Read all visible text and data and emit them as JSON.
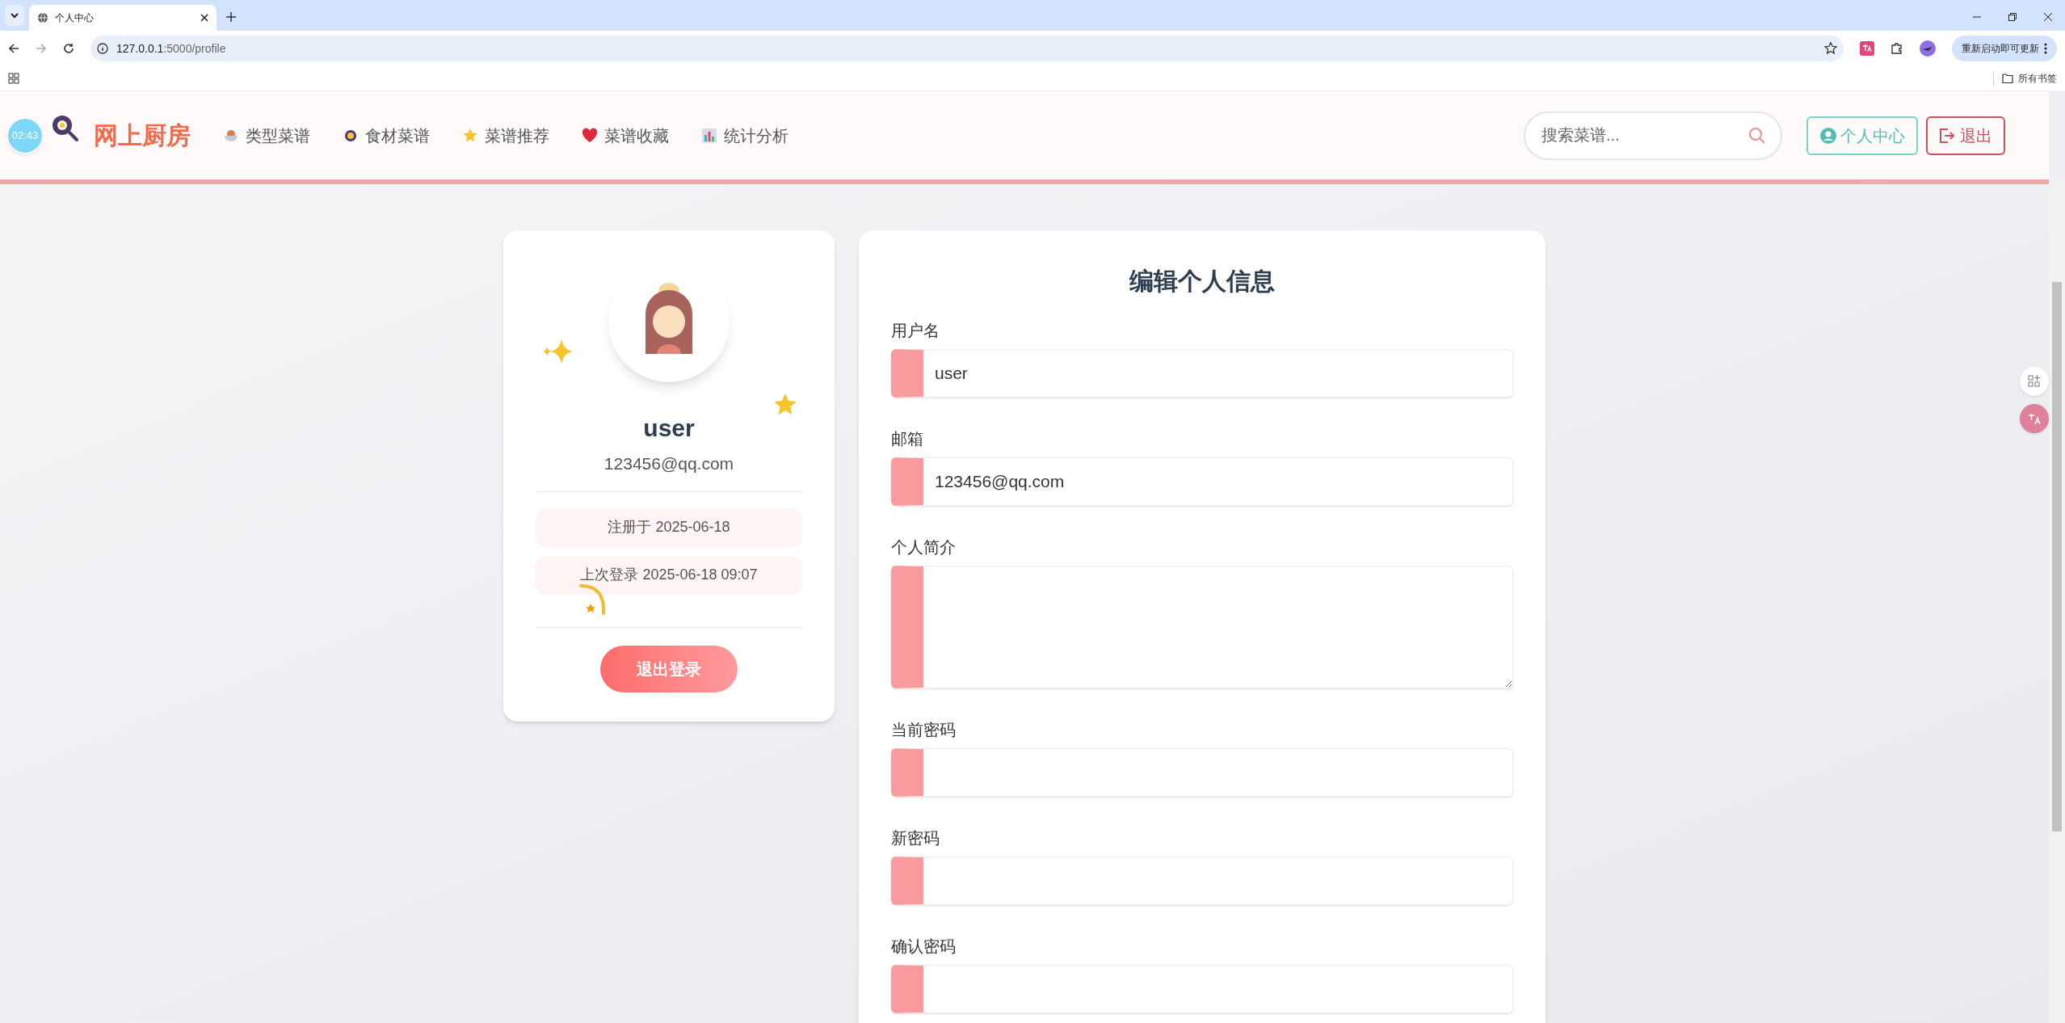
{
  "browser": {
    "tab_title": "个人中心",
    "url_host": "127.0.0.1",
    "url_path": ":5000/profile",
    "update_button": "重新启动即可更新",
    "bookmarks_folder": "所有书签"
  },
  "clock_badge": "02:43",
  "site": {
    "logo": "网上厨房",
    "nav": [
      {
        "label": "类型菜谱",
        "kind": "bowl"
      },
      {
        "label": "食材菜谱",
        "kind": "pan"
      },
      {
        "label": "菜谱推荐",
        "kind": "star"
      },
      {
        "label": "菜谱收藏",
        "kind": "heart"
      },
      {
        "label": "统计分析",
        "kind": "chart"
      }
    ],
    "search": {
      "placeholder": "搜索菜谱..."
    },
    "profile_button": "个人中心",
    "logout_button": "退出"
  },
  "profile": {
    "username": "user",
    "email": "123456@qq.com",
    "registered": "注册于 2025-06-18",
    "last_login": "上次登录 2025-06-18 09:07",
    "logout": "退出登录"
  },
  "form": {
    "title": "编辑个人信息",
    "fields": [
      {
        "label": "用户名",
        "value": "user",
        "kind": "text"
      },
      {
        "label": "邮箱",
        "value": "123456@qq.com",
        "kind": "text"
      },
      {
        "label": "个人简介",
        "kind": "textarea"
      },
      {
        "label": "当前密码",
        "kind": "password"
      },
      {
        "label": "新密码",
        "kind": "password"
      },
      {
        "label": "确认密码",
        "kind": "password"
      }
    ]
  }
}
